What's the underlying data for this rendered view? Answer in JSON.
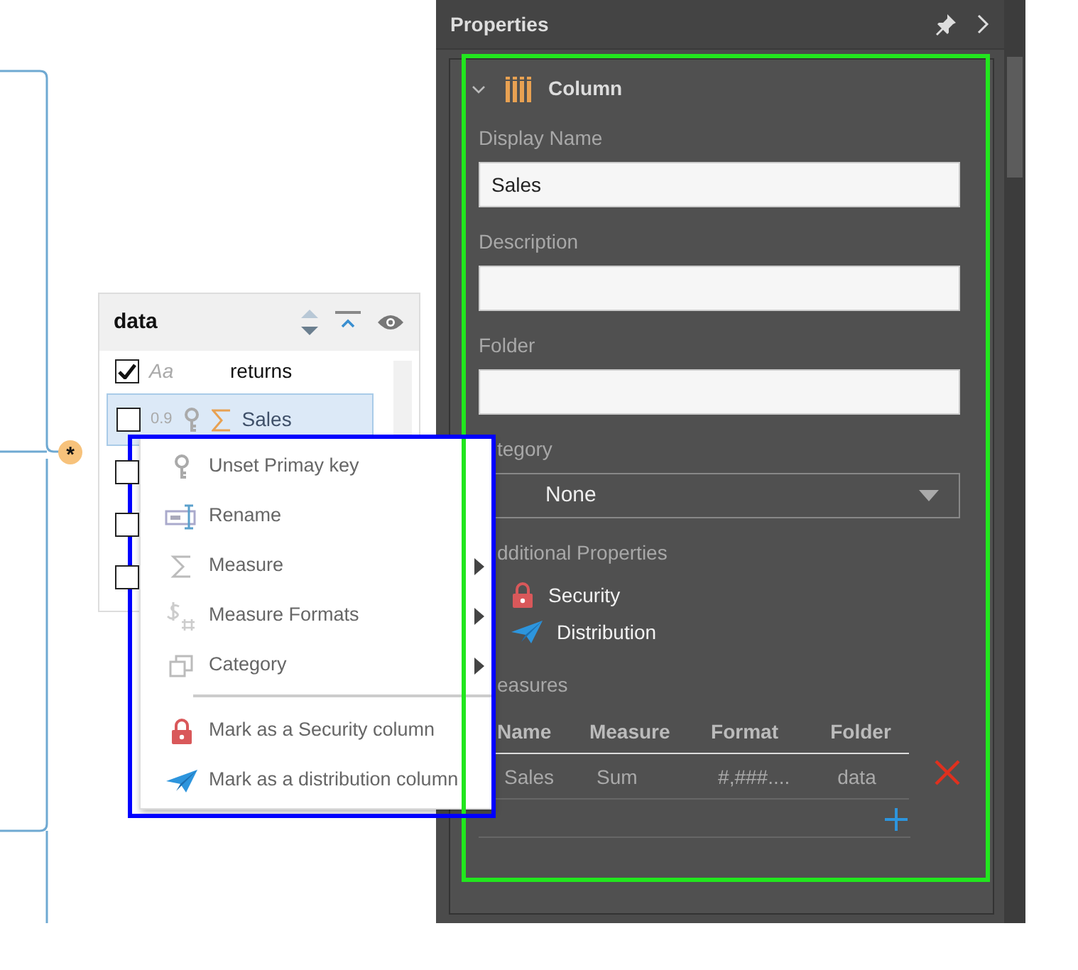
{
  "canvas": {
    "join_symbol": "*",
    "table": {
      "title": "data",
      "fields": [
        {
          "kind": "text",
          "checked": true,
          "type_label": "Aa",
          "name": "returns",
          "selected": false
        },
        {
          "kind": "measure",
          "checked": false,
          "cardinality": "0.9",
          "name": "Sales",
          "selected": true
        },
        {
          "kind": "hidden",
          "checked": false,
          "selected": false
        },
        {
          "kind": "hidden",
          "checked": false,
          "selected": false
        },
        {
          "kind": "hidden",
          "checked": false,
          "selected": false
        }
      ]
    }
  },
  "context_menu": {
    "sections": [
      {
        "items": [
          {
            "kind": "key",
            "label": "Unset Primay key",
            "submenu": false
          },
          {
            "kind": "rename",
            "label": "Rename",
            "submenu": false
          },
          {
            "kind": "measure",
            "label": "Measure",
            "submenu": true
          },
          {
            "kind": "formats",
            "label": "Measure Formats",
            "submenu": true
          },
          {
            "kind": "category",
            "label": "Category",
            "submenu": true
          }
        ]
      },
      {
        "items": [
          {
            "kind": "security",
            "label": "Mark as a Security column",
            "submenu": false
          },
          {
            "kind": "distribution",
            "label": "Mark as a distribution column",
            "submenu": false
          }
        ]
      }
    ]
  },
  "properties": {
    "title": "Properties",
    "section": {
      "title": "Column",
      "expanded": true,
      "fields": [
        {
          "label": "Display Name",
          "value": "Sales"
        },
        {
          "label": "Description"
        },
        {
          "label": "Folder"
        }
      ],
      "category": {
        "label": "tegory",
        "value": "None"
      },
      "additional": {
        "label": "dditional Properties",
        "items": [
          {
            "kind": "security",
            "label": "Security"
          },
          {
            "kind": "distribution",
            "label": "Distribution"
          }
        ]
      },
      "measures": {
        "label": "easures",
        "columns": [
          "Name",
          "Measure",
          "Format",
          "Folder"
        ],
        "rows": [
          [
            "Sales",
            "Sum",
            "#,###....",
            "data"
          ]
        ]
      }
    }
  },
  "highlights": [
    {
      "kind": "panel",
      "color": "#22e61e"
    },
    {
      "kind": "menu",
      "color": "#0000ff"
    }
  ]
}
